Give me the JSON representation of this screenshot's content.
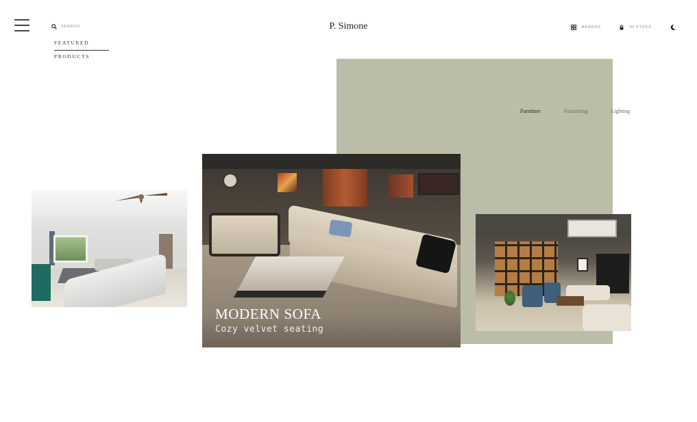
{
  "header": {
    "search_label": "SEARCH",
    "brand": "P. Simone",
    "brands_label": "BRANDS",
    "in_stock_label": "IN STOCK"
  },
  "nav": {
    "featured": "FEATURED",
    "products": "PRODUCTS"
  },
  "categories": {
    "furniture": "Furniture",
    "furnishing": "Furnishing",
    "lighting": "Lighting",
    "active": "Furniture"
  },
  "hero": {
    "title": "MODERN SOFA",
    "subtitle": "Cozy velvet seating"
  },
  "colors": {
    "panel": "#bcbda8",
    "background": "#ffffff",
    "text": "#222222"
  },
  "icons": [
    "menu-icon",
    "search-icon",
    "brands-grid-icon",
    "lock-icon",
    "moon-icon"
  ]
}
